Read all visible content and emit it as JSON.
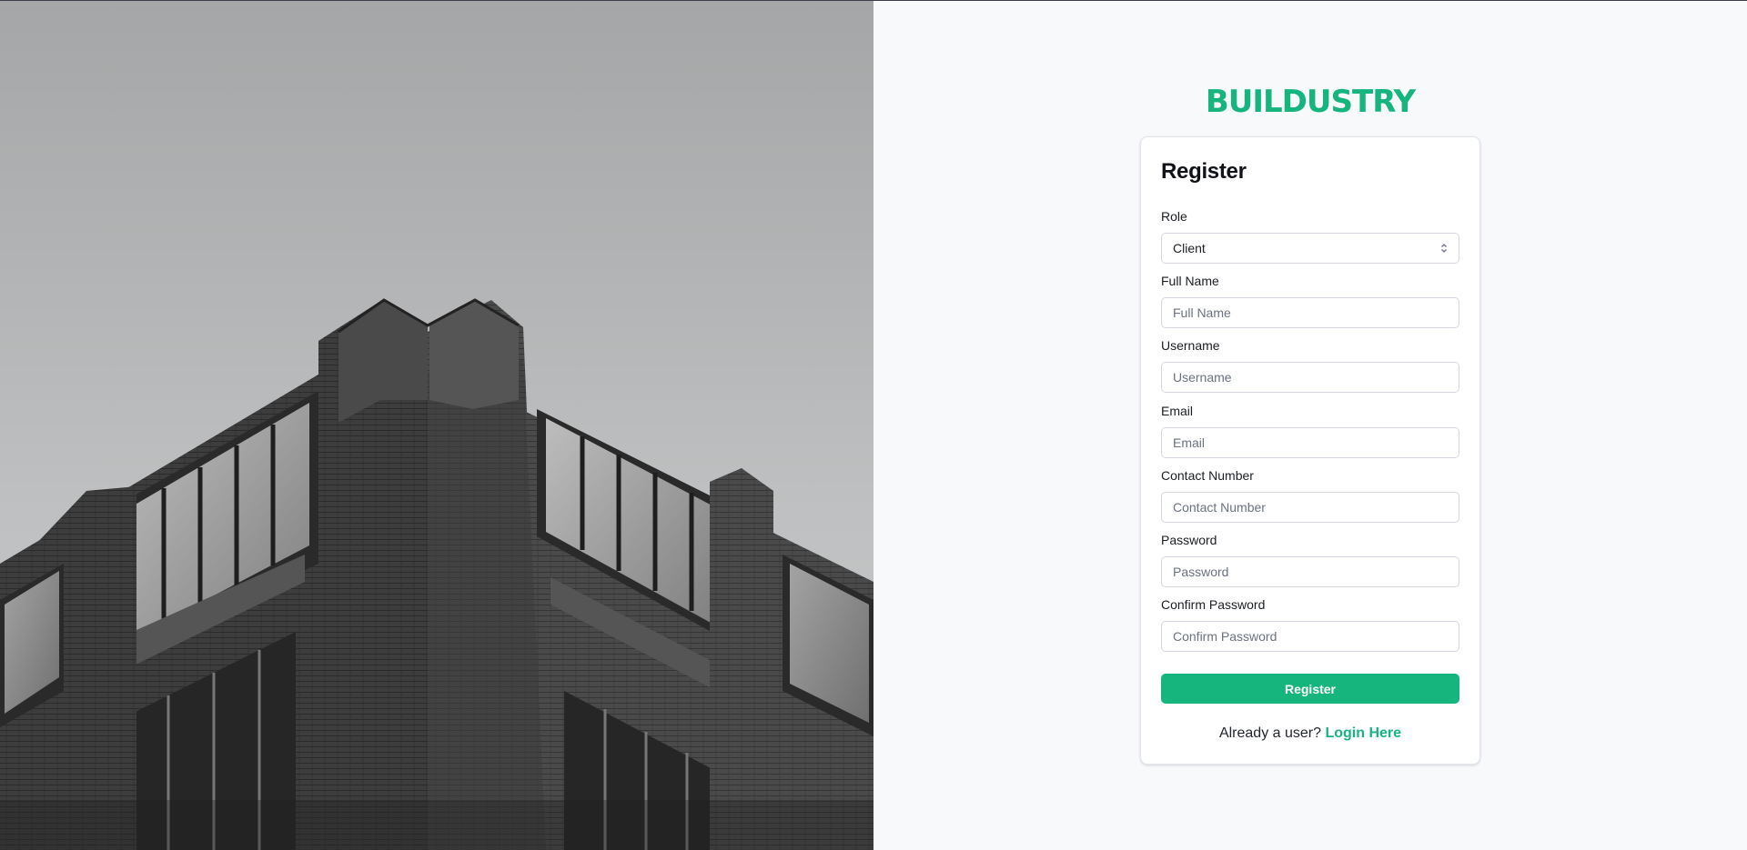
{
  "brand": {
    "name": "BUILDUSTRY",
    "color": "#16b57e"
  },
  "photo": {
    "subject": "building-photo"
  },
  "form": {
    "title": "Register",
    "role": {
      "label": "Role",
      "value": "Client"
    },
    "full_name": {
      "label": "Full Name",
      "placeholder": "Full Name"
    },
    "username": {
      "label": "Username",
      "placeholder": "Username"
    },
    "email": {
      "label": "Email",
      "placeholder": "Email"
    },
    "contact": {
      "label": "Contact Number",
      "placeholder": "Contact Number"
    },
    "password": {
      "label": "Password",
      "placeholder": "Password"
    },
    "confirm_password": {
      "label": "Confirm Password",
      "placeholder": "Confirm Password"
    },
    "submit_label": "Register",
    "footer": {
      "prompt": "Already a user?",
      "link_label": "Login Here"
    }
  },
  "icons": {
    "select": "chevron-up-down-icon"
  }
}
